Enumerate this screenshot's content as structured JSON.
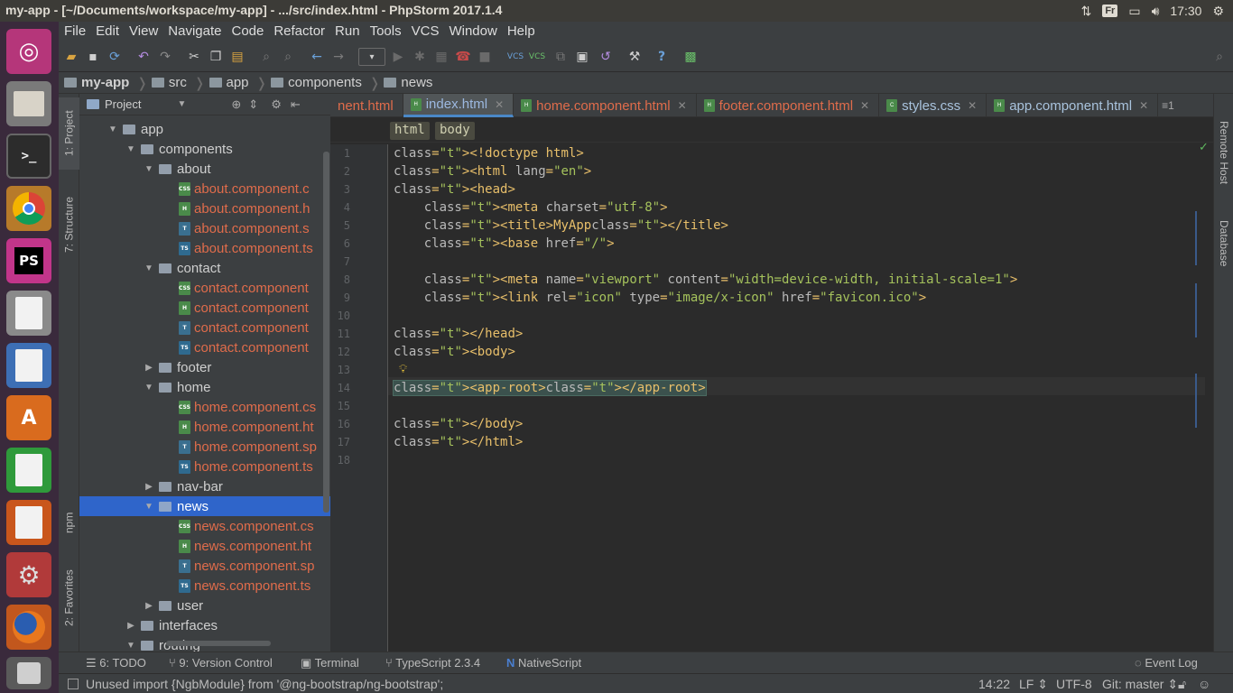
{
  "system": {
    "window_title": "my-app - [~/Documents/workspace/my-app] - .../src/index.html - PhpStorm 2017.1.4",
    "keyboard_layout": "Fr",
    "time": "17:30"
  },
  "launcher": [
    {
      "icon": "ubuntu-dash-icon"
    },
    {
      "icon": "files-icon"
    },
    {
      "icon": "terminal-icon"
    },
    {
      "icon": "chrome-icon"
    },
    {
      "icon": "phpstorm-icon",
      "label": "PS"
    },
    {
      "icon": "text-editor-icon"
    },
    {
      "icon": "writer-icon"
    },
    {
      "icon": "software-center-icon",
      "label": "A"
    },
    {
      "icon": "calc-icon"
    },
    {
      "icon": "impress-icon"
    },
    {
      "icon": "settings-icon"
    },
    {
      "icon": "firefox-icon"
    },
    {
      "icon": "trash-icon"
    }
  ],
  "menu": [
    "File",
    "Edit",
    "View",
    "Navigate",
    "Code",
    "Refactor",
    "Run",
    "Tools",
    "VCS",
    "Window",
    "Help"
  ],
  "breadcrumb": [
    "my-app",
    "src",
    "app",
    "components",
    "news"
  ],
  "left_tool_tabs": {
    "project": "1: Project",
    "structure": "7: Structure",
    "npm": "npm",
    "favorites": "2: Favorites"
  },
  "right_tool_tabs": {
    "remote": "Remote Host",
    "database": "Database"
  },
  "project_panel": {
    "title": "Project"
  },
  "tree": [
    {
      "label": "app",
      "type": "folder",
      "depth": 0,
      "open": true
    },
    {
      "label": "components",
      "type": "folder",
      "depth": 1,
      "open": true
    },
    {
      "label": "about",
      "type": "folder",
      "depth": 2,
      "open": true
    },
    {
      "label": "about.component.c",
      "type": "css",
      "depth": 3
    },
    {
      "label": "about.component.h",
      "type": "htm",
      "depth": 3
    },
    {
      "label": "about.component.s",
      "type": "spec",
      "depth": 3
    },
    {
      "label": "about.component.ts",
      "type": "ts",
      "depth": 3
    },
    {
      "label": "contact",
      "type": "folder",
      "depth": 2,
      "open": true
    },
    {
      "label": "contact.component",
      "type": "css",
      "depth": 3
    },
    {
      "label": "contact.component",
      "type": "htm",
      "depth": 3
    },
    {
      "label": "contact.component",
      "type": "spec",
      "depth": 3
    },
    {
      "label": "contact.component",
      "type": "ts",
      "depth": 3
    },
    {
      "label": "footer",
      "type": "folder",
      "depth": 2,
      "open": false
    },
    {
      "label": "home",
      "type": "folder",
      "depth": 2,
      "open": true
    },
    {
      "label": "home.component.cs",
      "type": "css",
      "depth": 3
    },
    {
      "label": "home.component.ht",
      "type": "htm",
      "depth": 3
    },
    {
      "label": "home.component.sp",
      "type": "spec",
      "depth": 3
    },
    {
      "label": "home.component.ts",
      "type": "ts",
      "depth": 3
    },
    {
      "label": "nav-bar",
      "type": "folder",
      "depth": 2,
      "open": false
    },
    {
      "label": "news",
      "type": "folder",
      "depth": 2,
      "open": true,
      "selected": true
    },
    {
      "label": "news.component.cs",
      "type": "css",
      "depth": 3
    },
    {
      "label": "news.component.ht",
      "type": "htm",
      "depth": 3
    },
    {
      "label": "news.component.sp",
      "type": "spec",
      "depth": 3
    },
    {
      "label": "news.component.ts",
      "type": "ts",
      "depth": 3
    },
    {
      "label": "user",
      "type": "folder",
      "depth": 2,
      "open": false
    },
    {
      "label": "interfaces",
      "type": "folder",
      "depth": 1,
      "open": false
    },
    {
      "label": "routing",
      "type": "folder",
      "depth": 1,
      "open": true
    }
  ],
  "tabs": [
    {
      "label": "nent.html",
      "active": false
    },
    {
      "label": "index.html",
      "active": true
    },
    {
      "label": "home.component.html",
      "active": false
    },
    {
      "label": "footer.component.html",
      "active": false
    },
    {
      "label": "styles.css",
      "active": false
    },
    {
      "label": "app.component.html",
      "active": false
    }
  ],
  "tabs_overflow": "≡1",
  "tag_breadcrumb": [
    "html",
    "body"
  ],
  "code_lines": [
    "<!doctype html>",
    "<html lang=\"en\">",
    "<head>",
    "    <meta charset=\"utf-8\">",
    "    <title>MyApp</title>",
    "    <base href=\"/\">",
    "",
    "    <meta name=\"viewport\" content=\"width=device-width, initial-scale=1\">",
    "    <link rel=\"icon\" type=\"image/x-icon\" href=\"favicon.ico\">",
    "",
    "</head>",
    "<body>",
    "",
    "<app-root></app-root>",
    "",
    "</body>",
    "</html>",
    ""
  ],
  "bottom_tools": {
    "todo": "6: TODO",
    "vcs": "9: Version Control",
    "terminal": "Terminal",
    "typescript": "TypeScript 2.3.4",
    "nativescript": "NativeScript",
    "event_log": "Event Log"
  },
  "status": {
    "message": "Unused import {NgbModule} from '@ng-bootstrap/ng-bootstrap';",
    "position": "14:22",
    "line_sep": "LF",
    "encoding": "UTF-8",
    "git": "Git: master"
  },
  "colors": {
    "accent": "#2f65ca",
    "file_red": "#e06c4b",
    "tag_yellow": "#e8bf6a",
    "string_green": "#a5c25c"
  }
}
